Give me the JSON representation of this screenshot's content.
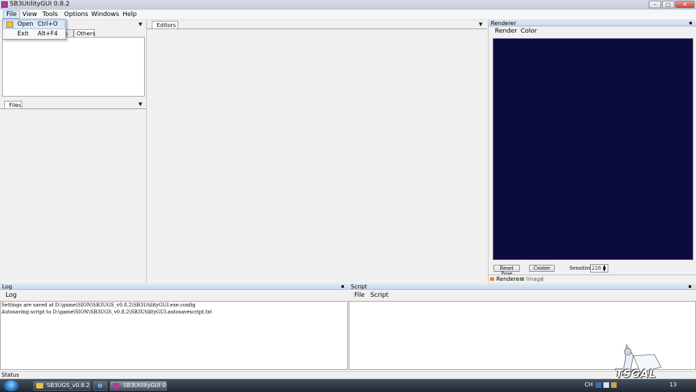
{
  "window": {
    "title": "SB3UtilityGUI 0.8.2"
  },
  "menubar": [
    "File",
    "View",
    "Tools",
    "Options",
    "Windows",
    "Help"
  ],
  "file_menu": [
    {
      "label": "Open",
      "shortcut": "Ctrl+O"
    },
    {
      "label": "Exit",
      "shortcut": "Alt+F4"
    }
  ],
  "left_panel": {
    "tabs": [
      "ss",
      "Others"
    ],
    "files_tab": "Files"
  },
  "editors": {
    "tab": "Editors"
  },
  "renderer": {
    "title": "Renderer",
    "menu": [
      "Render",
      "Color"
    ],
    "canvas_color": "#0b0b3d",
    "reset_pose": "Reset Pose",
    "center": "Center",
    "sensitivity_label": "Sensitivity",
    "sensitivity_value": "228",
    "bottom_tabs": [
      "Renderer",
      "Image"
    ]
  },
  "log": {
    "title": "Log",
    "menu": "Log",
    "lines": [
      "Settings are saved at D:\\game\\SION\\SB3UGS_v0.8.2\\SB3UtilityGUI.exe.config",
      "Autosaving script to D:\\game\\SION\\SB3UGS_v0.8.2\\SB3UtilityGUI.autosavescript.txt"
    ]
  },
  "script": {
    "title": "Script",
    "menu": [
      "File",
      "Script"
    ]
  },
  "status": "Status",
  "taskbar": {
    "items": [
      "SB3UGS_v0.8.2",
      "SB3UtilityGUI 0..."
    ],
    "lang": "CH",
    "clock": "13"
  },
  "watermark": "TSGAL"
}
